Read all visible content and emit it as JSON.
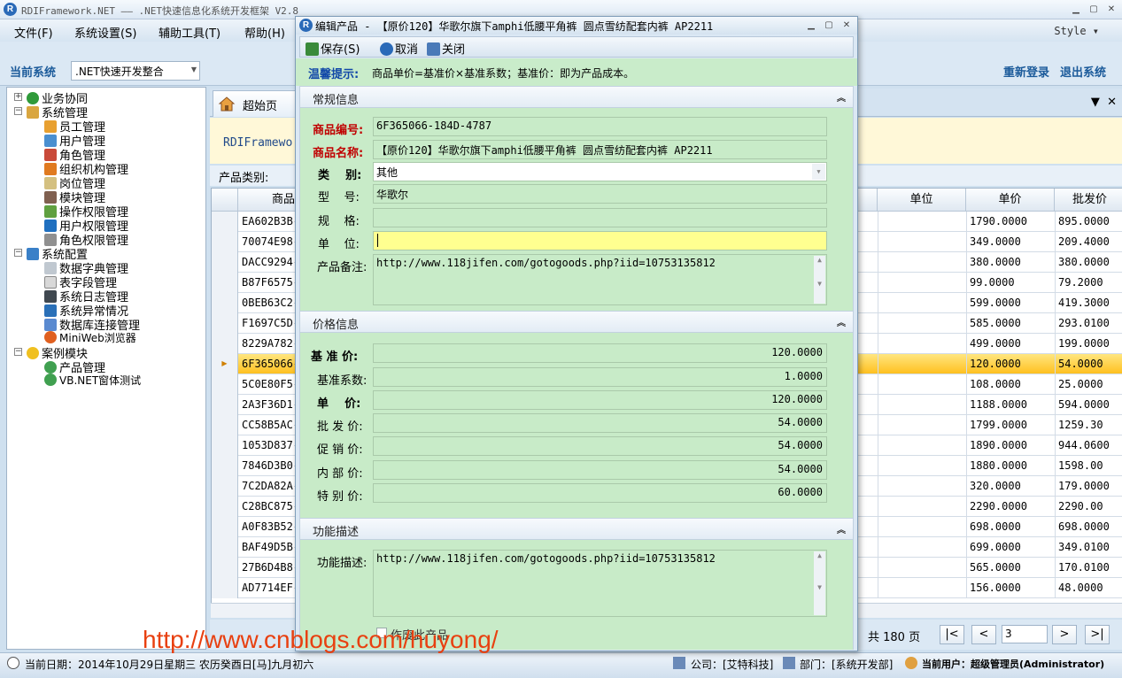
{
  "app": {
    "title": "RDIFramework.NET —— .NET快速信息化系统开发框架 V2.8",
    "menu": [
      "文件(F)",
      "系统设置(S)",
      "辅助工具(T)",
      "帮助(H)"
    ],
    "style_label": "Style",
    "current_system_label": "当前系统",
    "current_system_value": ".NET快速开发整合",
    "relogin": "重新登录",
    "exit": "退出系统"
  },
  "tree": {
    "n0": "业务协同",
    "n1": "系统管理",
    "n2": "员工管理",
    "n3": "用户管理",
    "n4": "角色管理",
    "n5": "组织机构管理",
    "n6": "岗位管理",
    "n7": "模块管理",
    "n8": "操作权限管理",
    "n9": "用户权限管理",
    "n10": "角色权限管理",
    "n11": "系统配置",
    "n12": "数据字典管理",
    "n13": "表字段管理",
    "n14": "系统日志管理",
    "n15": "系统异常情况",
    "n16": "数据库连接管理",
    "n17": "MiniWeb浏览器",
    "n18": "案例模块",
    "n19": "产品管理",
    "n20": "VB.NET窗体测试"
  },
  "tabs": {
    "home": "超始页"
  },
  "main": {
    "info_text": "RDIFramewo",
    "filter_label": "产品类别:"
  },
  "grid": {
    "headers": {
      "code": "商品",
      "unit": "单位",
      "price": "单价",
      "wholesale": "批发价"
    },
    "rows": [
      [
        "EA602B3B-",
        "1790.0000",
        "895.0000"
      ],
      [
        "70074E98-",
        "349.0000",
        "209.4000"
      ],
      [
        "DACC9294-",
        "380.0000",
        "380.0000"
      ],
      [
        "B87F6575-",
        "99.0000",
        "79.2000"
      ],
      [
        "0BEB63C2-",
        "599.0000",
        "419.3000"
      ],
      [
        "F1697C5D-",
        "585.0000",
        "293.0100"
      ],
      [
        "8229A782-",
        "499.0000",
        "199.0000"
      ],
      [
        "6F365066-",
        "120.0000",
        "54.0000"
      ],
      [
        "5C0E80F5-",
        "108.0000",
        "25.0000"
      ],
      [
        "2A3F36D1-",
        "1188.0000",
        "594.0000"
      ],
      [
        "CC58B5AC-",
        "1799.0000",
        "1259.30"
      ],
      [
        "1053D837-",
        "1890.0000",
        "944.0600"
      ],
      [
        "7846D3B0-",
        "1880.0000",
        "1598.00"
      ],
      [
        "7C2DA82A-",
        "320.0000",
        "179.0000"
      ],
      [
        "C28BC875-",
        "2290.0000",
        "2290.00"
      ],
      [
        "A0F83B52-",
        "698.0000",
        "698.0000"
      ],
      [
        "BAF49D5B-",
        "699.0000",
        "349.0100"
      ],
      [
        "27B6D4B8-",
        "565.0000",
        "170.0100"
      ],
      [
        "AD7714EF-",
        "156.0000",
        "48.0000"
      ]
    ],
    "selected_index": 7
  },
  "pager": {
    "total": "共 180 页",
    "first": "|<",
    "prev": "<",
    "page_value": "3",
    "next": ">",
    "last": ">|"
  },
  "status": {
    "date": "当前日期：2014年10月29日星期三 农历癸酉日[马]九月初六",
    "company": "公司：[艾特科技]",
    "dept": "部门：[系统开发部]",
    "user": "当前用户：超级管理员(Administrator)"
  },
  "watermark": "http://www.cnblogs.com/huyong/",
  "dialog": {
    "title": "编辑产品 - 【原价120】华歌尔旗下amphi低腰平角裤 圆点雪纺配套内裤 AP2211",
    "toolbar": {
      "save": "保存(S)",
      "cancel": "取消",
      "close": "关闭"
    },
    "hint_key": "温馨提示:",
    "hint_text": "商品单价=基准价×基准系数；基准价：即为产品成本。",
    "sections": {
      "general": "常规信息",
      "price": "价格信息",
      "desc": "功能描述"
    },
    "general": {
      "code_label": "商品编号:",
      "code_value": "6F365066-184D-4787",
      "name_label": "商品名称:",
      "name_value": "【原价120】华歌尔旗下amphi低腰平角裤 圆点雪纺配套内裤 AP2211",
      "category_label": "类    别:",
      "category_value": "其他",
      "model_label": "型    号:",
      "model_value": "华歌尔",
      "spec_label": "规    格:",
      "spec_value": "",
      "unit_label": "单    位:",
      "unit_value": "",
      "remark_label": "产品备注:",
      "remark_value": "http://www.118jifen.com/gotogoods.php?iid=10753135812"
    },
    "price": {
      "base_label": "基 准 价:",
      "base_value": "120.0000",
      "coef_label": "基准系数:",
      "coef_value": "1.0000",
      "unit_price_label": "单    价:",
      "unit_price_value": "120.0000",
      "wholesale_label": "批 发 价:",
      "wholesale_value": "54.0000",
      "promo_label": "促 销 价:",
      "promo_value": "54.0000",
      "internal_label": "内 部 价:",
      "internal_value": "54.0000",
      "special_label": "特 别 价:",
      "special_value": "60.0000"
    },
    "desc": {
      "label": "功能描述:",
      "value": "http://www.118jifen.com/gotogoods.php?iid=10753135812"
    },
    "discard_label": "作废此产品"
  }
}
